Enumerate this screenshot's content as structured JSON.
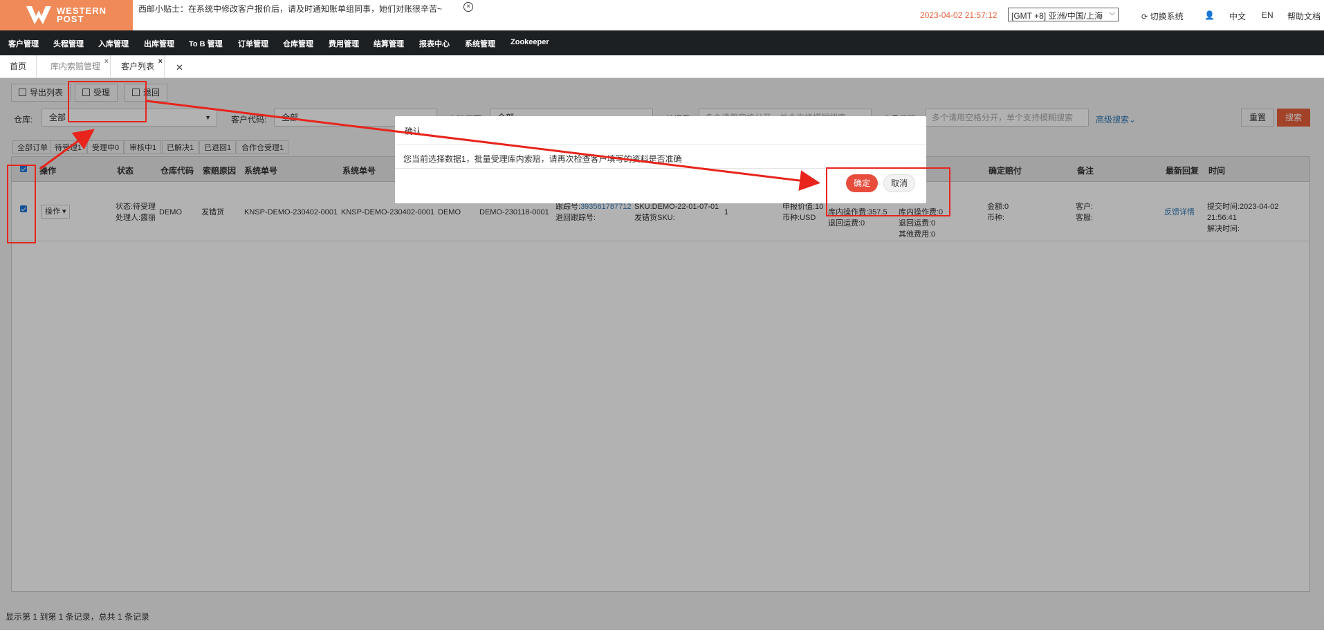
{
  "header": {
    "logo_line1": "WESTERN",
    "logo_line2": "POST",
    "tip": "西邮小贴士：在系统中修改客户报价后，请及时通知账单组同事，她们对账很辛苦~",
    "datetime": "2023-04-02 21:57:12",
    "timezone": "[GMT +8] 亚洲/中国/上海",
    "switch_system": "切换系统",
    "lang_zh": "中文",
    "lang_en": "EN",
    "help": "帮助文档"
  },
  "nav": {
    "items": [
      "客户管理",
      "头程管理",
      "入库管理",
      "出库管理",
      "To B 管理",
      "订单管理",
      "仓库管理",
      "费用管理",
      "结算管理",
      "报表中心",
      "系统管理",
      "Zookeeper"
    ]
  },
  "tabs": {
    "items": [
      "首页",
      "库内索赔管理",
      "客户列表"
    ]
  },
  "toolbar": {
    "export": "导出列表",
    "accept": "受理",
    "return": "退回"
  },
  "filters": {
    "warehouse_label": "仓库:",
    "warehouse_value": "全部",
    "customer_label": "客户代码:",
    "customer_value": "全部",
    "reason_label": "索赔原因",
    "reason_value": "全部",
    "tracking_label": "单据号",
    "tracking_placeholder": "多个请用空格分开，单个支持模糊搜索",
    "product_label": "产品代码",
    "product_placeholder": "多个请用空格分开，单个支持模糊搜索",
    "advanced": "高级搜索",
    "reset": "重置",
    "search": "搜索"
  },
  "status_tabs": [
    "全部订单",
    "待受理1",
    "受理中0",
    "审核中1",
    "已解决1",
    "已退回1",
    "合作仓受理1"
  ],
  "table": {
    "headers": [
      "操作",
      "状态",
      "仓库代码",
      "索赔原因",
      "系统单号",
      "系统单号",
      "确定赔付",
      "备注",
      "最新回复",
      "时间"
    ],
    "row": {
      "op_button": "操作",
      "status1": "状态:待受理",
      "status2": "处理人:露丽",
      "warehouse": "DEMO",
      "reason": "发错货",
      "sys_no1": "KNSP-DEMO-230402-0001",
      "sys_no2": "KNSP-DEMO-230402-0001",
      "wh2": "DEMO",
      "order_no": "DEMO-230118-0001",
      "track_label": "跟踪号:",
      "track_no": "393561787712",
      "return_track": "退回跟踪号:",
      "sku": "SKU:DEMO-22-01-07-01",
      "wrong_sku": "发错货SKU:",
      "qty": "1",
      "declared": "申报价值:10",
      "currency": "币种:USD",
      "fee1": "库内操作费:357.5",
      "fee2": "退回运费:0",
      "fee3a": "0",
      "fee3b": "0",
      "fee4": "库内操作费:0",
      "fee5": "退回运费:0",
      "fee6": "其他费用:0",
      "pay_amount": "金额:0",
      "pay_currency": "币种:",
      "note_customer": "客户:",
      "note_review": "客服:",
      "reply": "反馈详情",
      "submit_time": "提交时间:2023-04-02 21:56:41",
      "solve_time": "解决时间:"
    }
  },
  "pager": "显示第 1 到第 1 条记录，总共 1 条记录",
  "modal": {
    "title": "确认",
    "message": "您当前选择数据1，批量受理库内索赔，请再次检查客户填写的资料是否准确",
    "ok": "确定",
    "cancel": "取消"
  },
  "colors": {
    "brand": "#f08b59",
    "nav_bg": "#1d2023",
    "accent": "#e8603c",
    "annotation": "#e8241c"
  }
}
